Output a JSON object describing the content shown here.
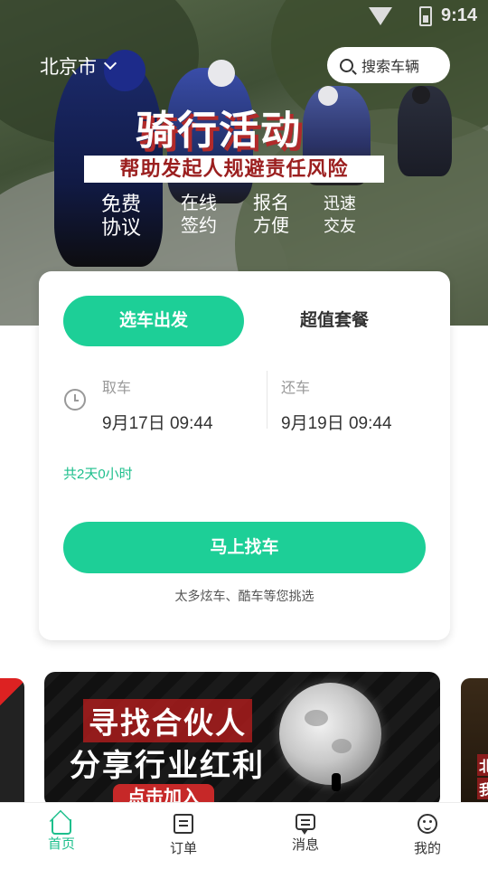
{
  "status_bar": {
    "time": "9:14",
    "icons": [
      "signal-icon",
      "battery-icon"
    ]
  },
  "header": {
    "city": "北京市",
    "search_placeholder": "搜索车辆"
  },
  "hero": {
    "title": "骑行活动",
    "subtitle": "帮助发起人规避责任风险",
    "features": [
      {
        "line1": "免费",
        "line2": "协议"
      },
      {
        "line1": "在线",
        "line2": "签约"
      },
      {
        "line1": "报名",
        "line2": "方便"
      },
      {
        "line1": "迅速",
        "line2": "交友"
      }
    ]
  },
  "booking": {
    "tabs": {
      "active": "选车出发",
      "other": "超值套餐"
    },
    "pickup": {
      "label": "取车",
      "value": "9月17日 09:44"
    },
    "return": {
      "label": "还车",
      "value": "9月19日 09:44"
    },
    "duration": "共2天0小时",
    "find_button": "马上找车",
    "hint": "太多炫车、酷车等您挑选"
  },
  "banner": {
    "line1": "寻找合伙人",
    "line2": "分享行业红利",
    "cta": "点击加入",
    "side_right_text": [
      "北",
      "我"
    ]
  },
  "colors": {
    "accent": "#1dcf97",
    "accent_text": "#1dbf8c",
    "subtitle_red": "#9b1f1f"
  },
  "tabbar": {
    "items": [
      {
        "label": "首页",
        "icon": "home-icon",
        "active": true
      },
      {
        "label": "订单",
        "icon": "order-icon",
        "active": false
      },
      {
        "label": "消息",
        "icon": "message-icon",
        "active": false
      },
      {
        "label": "我的",
        "icon": "profile-icon",
        "active": false
      }
    ]
  }
}
